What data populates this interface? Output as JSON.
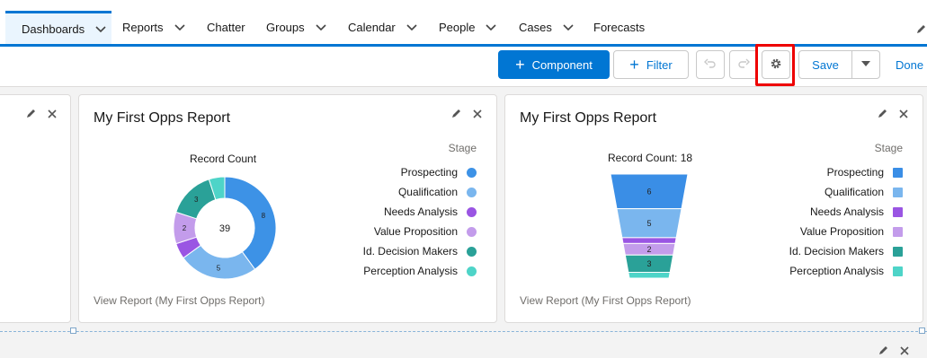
{
  "nav": {
    "items": [
      {
        "label": "Dashboards",
        "chevron": true,
        "active": true
      },
      {
        "label": "Reports",
        "chevron": true
      },
      {
        "label": "Chatter",
        "chevron": false
      },
      {
        "label": "Groups",
        "chevron": true
      },
      {
        "label": "Calendar",
        "chevron": true
      },
      {
        "label": "People",
        "chevron": true
      },
      {
        "label": "Cases",
        "chevron": true
      },
      {
        "label": "Forecasts",
        "chevron": false
      }
    ]
  },
  "toolbar": {
    "component_label": "Component",
    "filter_label": "Filter",
    "save_label": "Save",
    "done_label": "Done"
  },
  "cards": {
    "donut": {
      "title": "My First Opps Report",
      "caption": "Record Count",
      "center_total": "39",
      "view_report": "View Report (My First Opps Report)"
    },
    "funnel": {
      "title": "My First Opps Report",
      "caption": "Record Count: 18",
      "view_report": "View Report (My First Opps Report)"
    }
  },
  "legend": {
    "title": "Stage",
    "items": [
      {
        "label": "Prospecting",
        "color_dot": "#3d92e6",
        "color_sq": "#3a8ee6"
      },
      {
        "label": "Qualification",
        "color_dot": "#7ab6ee",
        "color_sq": "#7ab6ee"
      },
      {
        "label": "Needs Analysis",
        "color_dot": "#9a55e3",
        "color_sq": "#9a55e3"
      },
      {
        "label": "Value Proposition",
        "color_dot": "#c39ceb",
        "color_sq": "#c39ceb"
      },
      {
        "label": "Id. Decision Makers",
        "color_dot": "#2aa198",
        "color_sq": "#2aa198"
      },
      {
        "label": "Perception Analysis",
        "color_dot": "#4ed4c8",
        "color_sq": "#4ed4c8"
      }
    ]
  },
  "chart_data": [
    {
      "type": "pie",
      "title": "Record Count",
      "categories": [
        "Prospecting",
        "Qualification",
        "Needs Analysis",
        "Value Proposition",
        "Id. Decision Makers",
        "Perception Analysis"
      ],
      "values": [
        8,
        5,
        1,
        2,
        3,
        1
      ],
      "data_labels": [
        "8",
        "5",
        "",
        "2",
        "3",
        ""
      ],
      "center_label": "39",
      "colors": [
        "#3d92e6",
        "#7ab6ee",
        "#9a55e3",
        "#c39ceb",
        "#2aa198",
        "#4ed4c8"
      ],
      "legend": "right"
    },
    {
      "type": "bar",
      "title": "Record Count: 18",
      "categories": [
        "Prospecting",
        "Qualification",
        "Needs Analysis",
        "Value Proposition",
        "Id. Decision Makers",
        "Perception Analysis"
      ],
      "values": [
        6,
        5,
        1,
        2,
        3,
        1
      ],
      "data_labels": [
        "6",
        "5",
        "",
        "2",
        "3",
        ""
      ],
      "colors": [
        "#3a8ee6",
        "#7ab6ee",
        "#9a55e3",
        "#c39ceb",
        "#2aa198",
        "#4ed4c8"
      ],
      "legend": "right"
    }
  ]
}
